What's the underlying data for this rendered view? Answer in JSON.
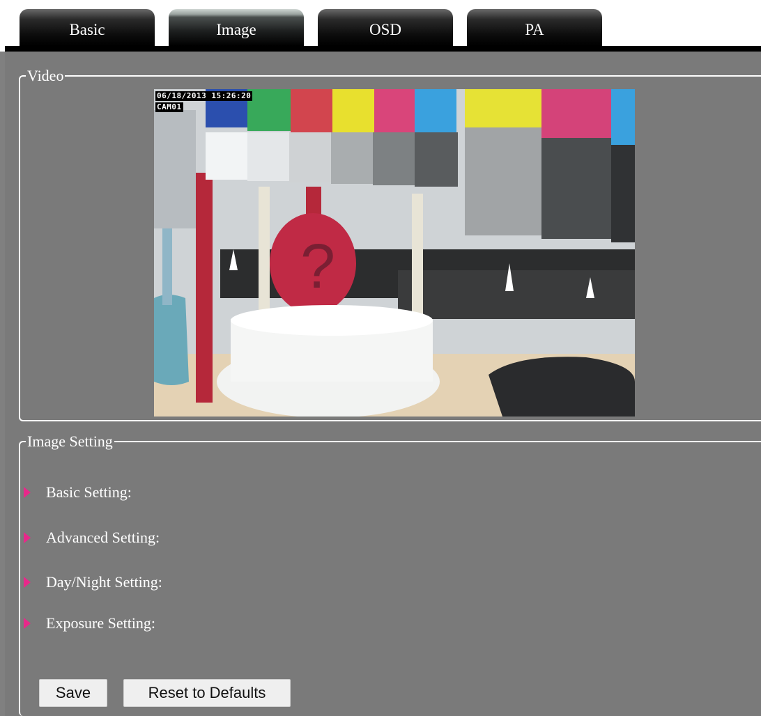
{
  "tabs": [
    {
      "label": "Basic",
      "active": false
    },
    {
      "label": "Image",
      "active": true
    },
    {
      "label": "OSD",
      "active": false
    },
    {
      "label": "PA",
      "active": false
    }
  ],
  "video_section": {
    "legend": "Video",
    "osd_datetime": "06/18/2013 15:26:20",
    "osd_camera": "CAM01"
  },
  "image_setting": {
    "legend": "Image Setting",
    "items": [
      {
        "label": "Basic Setting:",
        "icon": "arrow-right-icon"
      },
      {
        "label": "Advanced Setting:",
        "icon": "arrow-right-icon"
      },
      {
        "label": "Day/Night Setting:",
        "icon": "arrow-right-icon"
      },
      {
        "label": "Exposure Setting:",
        "icon": "arrow-right-icon"
      }
    ]
  },
  "buttons": {
    "save": "Save",
    "reset": "Reset to Defaults"
  },
  "colors": {
    "panel_background": "#7a7a7a",
    "arrow_accent": "#e8288a",
    "tab_bar": "#000000"
  }
}
